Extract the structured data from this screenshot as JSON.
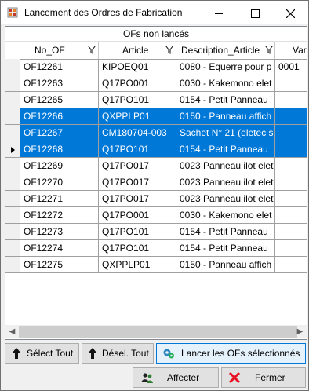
{
  "window": {
    "title": "Lancement des Ordres de Fabrication"
  },
  "grid": {
    "band_title": "OFs non lancés",
    "columns": [
      "No_OF",
      "Article",
      "Description_Article",
      "Var"
    ],
    "rows": [
      {
        "no_of": "OF12261",
        "article": "KIPOEQ01",
        "description": "0080 - Equerre pour p",
        "var": "0001",
        "selected": false,
        "current": false
      },
      {
        "no_of": "OF12263",
        "article": "Q17PO001",
        "description": "0030 - Kakemono  elet",
        "var": "",
        "selected": false,
        "current": false
      },
      {
        "no_of": "OF12265",
        "article": "Q17PO101",
        "description": "0154 - Petit Panneau",
        "var": "",
        "selected": false,
        "current": false
      },
      {
        "no_of": "OF12266",
        "article": "QXPPLP01",
        "description": "0150 - Panneau affich",
        "var": "",
        "selected": true,
        "current": false
      },
      {
        "no_of": "OF12267",
        "article": "CM180704-003",
        "description": "Sachet N° 21 (eletec si",
        "var": "",
        "selected": true,
        "current": false
      },
      {
        "no_of": "OF12268",
        "article": "Q17PO101",
        "description": "0154 - Petit Panneau",
        "var": "",
        "selected": true,
        "current": true
      },
      {
        "no_of": "OF12269",
        "article": "Q17PO017",
        "description": "0023 Panneau ilot elet",
        "var": "",
        "selected": false,
        "current": false
      },
      {
        "no_of": "OF12270",
        "article": "Q17PO017",
        "description": "0023 Panneau ilot elet",
        "var": "",
        "selected": false,
        "current": false
      },
      {
        "no_of": "OF12271",
        "article": "Q17PO017",
        "description": "0023 Panneau ilot elet",
        "var": "",
        "selected": false,
        "current": false
      },
      {
        "no_of": "OF12272",
        "article": "Q17PO001",
        "description": "0030 - Kakemono  elet",
        "var": "",
        "selected": false,
        "current": false
      },
      {
        "no_of": "OF12273",
        "article": "Q17PO101",
        "description": "0154 - Petit Panneau",
        "var": "",
        "selected": false,
        "current": false
      },
      {
        "no_of": "OF12274",
        "article": "Q17PO101",
        "description": "0154 - Petit Panneau",
        "var": "",
        "selected": false,
        "current": false
      },
      {
        "no_of": "OF12275",
        "article": "QXPPLP01",
        "description": "0150 - Panneau affich",
        "var": "",
        "selected": false,
        "current": false
      }
    ]
  },
  "buttons": {
    "select_all": "Sélect Tout",
    "deselect_all": "Désel. Tout",
    "launch": "Lancer les OFs sélectionnés",
    "assign": "Affecter",
    "close": "Fermer"
  },
  "colors": {
    "selection": "#0078d7",
    "close_icon": "#e81123"
  }
}
